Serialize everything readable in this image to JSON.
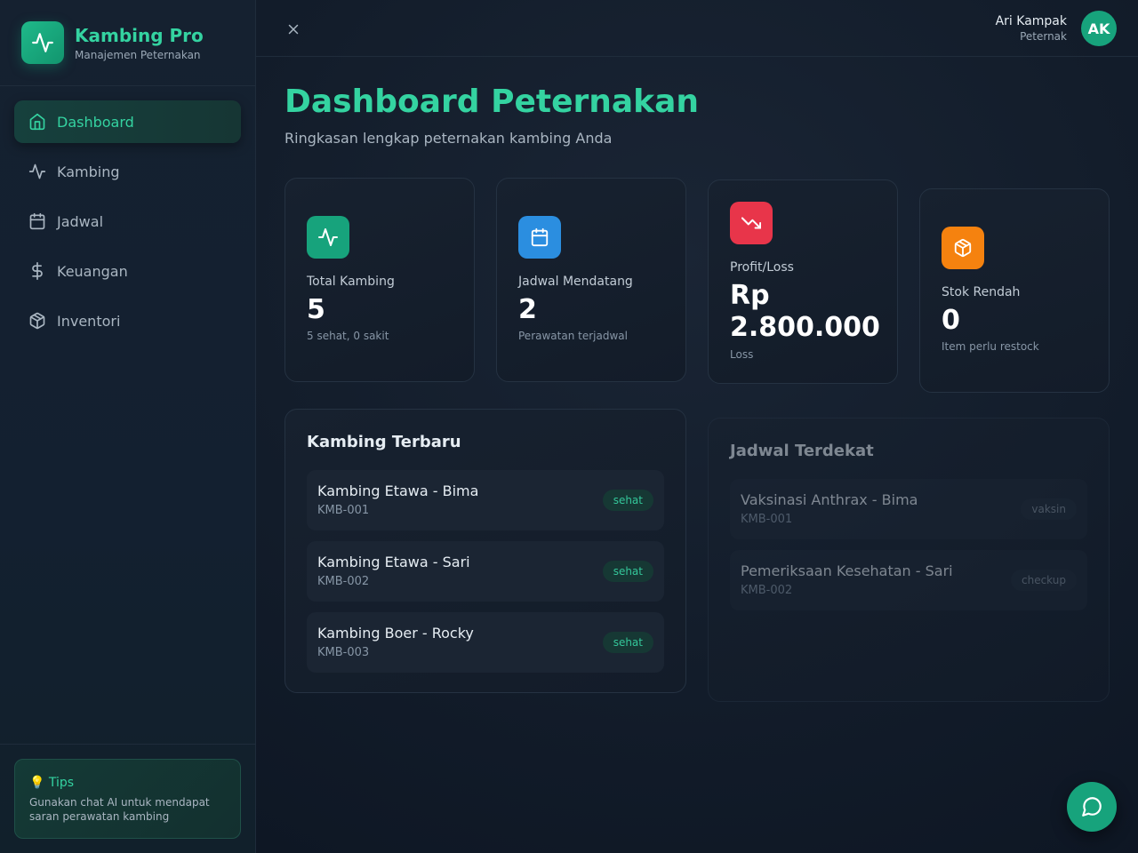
{
  "brand": {
    "title": "Kambing Pro",
    "subtitle": "Manajemen Peternakan",
    "icon": "activity-icon"
  },
  "sidebar": {
    "items": [
      {
        "label": "Dashboard",
        "icon": "home-icon",
        "active": true
      },
      {
        "label": "Kambing",
        "icon": "activity-icon",
        "active": false
      },
      {
        "label": "Jadwal",
        "icon": "calendar-icon",
        "active": false
      },
      {
        "label": "Keuangan",
        "icon": "dollar-icon",
        "active": false
      },
      {
        "label": "Inventori",
        "icon": "package-icon",
        "active": false
      }
    ],
    "tips": {
      "title": "💡 Tips",
      "body": "Gunakan chat AI untuk mendapat saran perawatan kambing"
    }
  },
  "user": {
    "name": "Ari Kampak",
    "role": "Peternak",
    "initials": "AK"
  },
  "page": {
    "title": "Dashboard Peternakan",
    "subtitle": "Ringkasan lengkap peternakan kambing Anda"
  },
  "stats": [
    {
      "label": "Total Kambing",
      "value": "5",
      "note": "5 sehat, 0 sakit",
      "icon": "activity-icon",
      "color": "#17a37c"
    },
    {
      "label": "Jadwal Mendatang",
      "value": "2",
      "note": "Perawatan terjadwal",
      "icon": "calendar-icon",
      "color": "#2b8ee0"
    },
    {
      "label": "Profit/Loss",
      "value_line1": "Rp",
      "value_line2": "2.800.000",
      "note": "Loss",
      "icon": "trending-down-icon",
      "color": "#e8354a"
    },
    {
      "label": "Stok Rendah",
      "value": "0",
      "note": "Item perlu restock",
      "icon": "package-icon",
      "color": "#f5820f"
    }
  ],
  "latest_goats": {
    "title": "Kambing Terbaru",
    "items": [
      {
        "name": "Kambing Etawa - Bima",
        "code": "KMB-001",
        "status": "sehat"
      },
      {
        "name": "Kambing Etawa - Sari",
        "code": "KMB-002",
        "status": "sehat"
      },
      {
        "name": "Kambing Boer - Rocky",
        "code": "KMB-003",
        "status": "sehat"
      }
    ]
  },
  "upcoming_schedule": {
    "title": "Jadwal Terdekat",
    "items": [
      {
        "name": "Vaksinasi Anthrax - Bima",
        "code": "KMB-001",
        "tag": "vaksin"
      },
      {
        "name": "Pemeriksaan Kesehatan - Sari",
        "code": "KMB-002",
        "tag": "checkup"
      }
    ]
  },
  "chat_button": {
    "icon": "chat-icon"
  },
  "close_button": {
    "icon": "close-icon"
  }
}
